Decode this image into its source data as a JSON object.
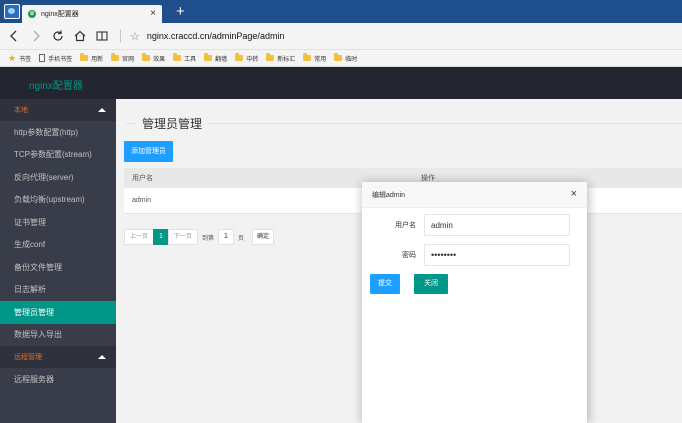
{
  "browser": {
    "tab_title": "nginx配置器",
    "tab_close": "×",
    "new_tab": "+",
    "url": "nginx.craccd.cn/adminPage/admin",
    "bookmarks": [
      {
        "label": "书签",
        "icon": "star-icon"
      },
      {
        "label": "手机书签",
        "icon": "page-icon"
      },
      {
        "label": "用新",
        "icon": "folder-icon"
      },
      {
        "label": "官网",
        "icon": "folder-icon"
      },
      {
        "label": "效果",
        "icon": "folder-icon"
      },
      {
        "label": "工具",
        "icon": "folder-icon"
      },
      {
        "label": "翻墙",
        "icon": "folder-icon"
      },
      {
        "label": "中转",
        "icon": "folder-icon"
      },
      {
        "label": "新标汇",
        "icon": "folder-icon"
      },
      {
        "label": "常用",
        "icon": "folder-icon"
      },
      {
        "label": "临时",
        "icon": "folder-icon"
      }
    ]
  },
  "app": {
    "logo": "nginx配置器"
  },
  "sidebar": {
    "group1": "本地",
    "items": [
      {
        "label": "http参数配置(http)"
      },
      {
        "label": "TCP参数配置(stream)"
      },
      {
        "label": "反向代理(server)"
      },
      {
        "label": "负载均衡(upstream)"
      },
      {
        "label": "证书管理"
      },
      {
        "label": "生成conf"
      },
      {
        "label": "备份文件管理"
      },
      {
        "label": "日志解析"
      },
      {
        "label": "管理员管理"
      },
      {
        "label": "数据导入导出"
      }
    ],
    "active_index": 8,
    "group2": "远程管理",
    "group2_items": [
      {
        "label": "远程服务器"
      }
    ]
  },
  "main": {
    "title": "管理员管理",
    "add_button": "添加管理员",
    "table": {
      "headers": [
        "用户名",
        "操作"
      ],
      "rows": [
        [
          "admin",
          ""
        ]
      ]
    },
    "pager": {
      "prev": "上一页",
      "current": "1",
      "next": "下一页",
      "goto_label": "到第",
      "page_input": "1",
      "page_unit": "页",
      "confirm": "确定"
    }
  },
  "modal": {
    "title": "编辑admin",
    "close": "×",
    "username_label": "用户名",
    "username_value": "admin",
    "password_label": "密码",
    "password_value": "••••••••",
    "submit": "提交",
    "close_button": "关闭"
  },
  "colors": {
    "accent": "#009688",
    "primary": "#1e9fff",
    "sidebar_bg": "#393d49",
    "header_bg": "#23262e",
    "group_text": "#e26d26"
  }
}
